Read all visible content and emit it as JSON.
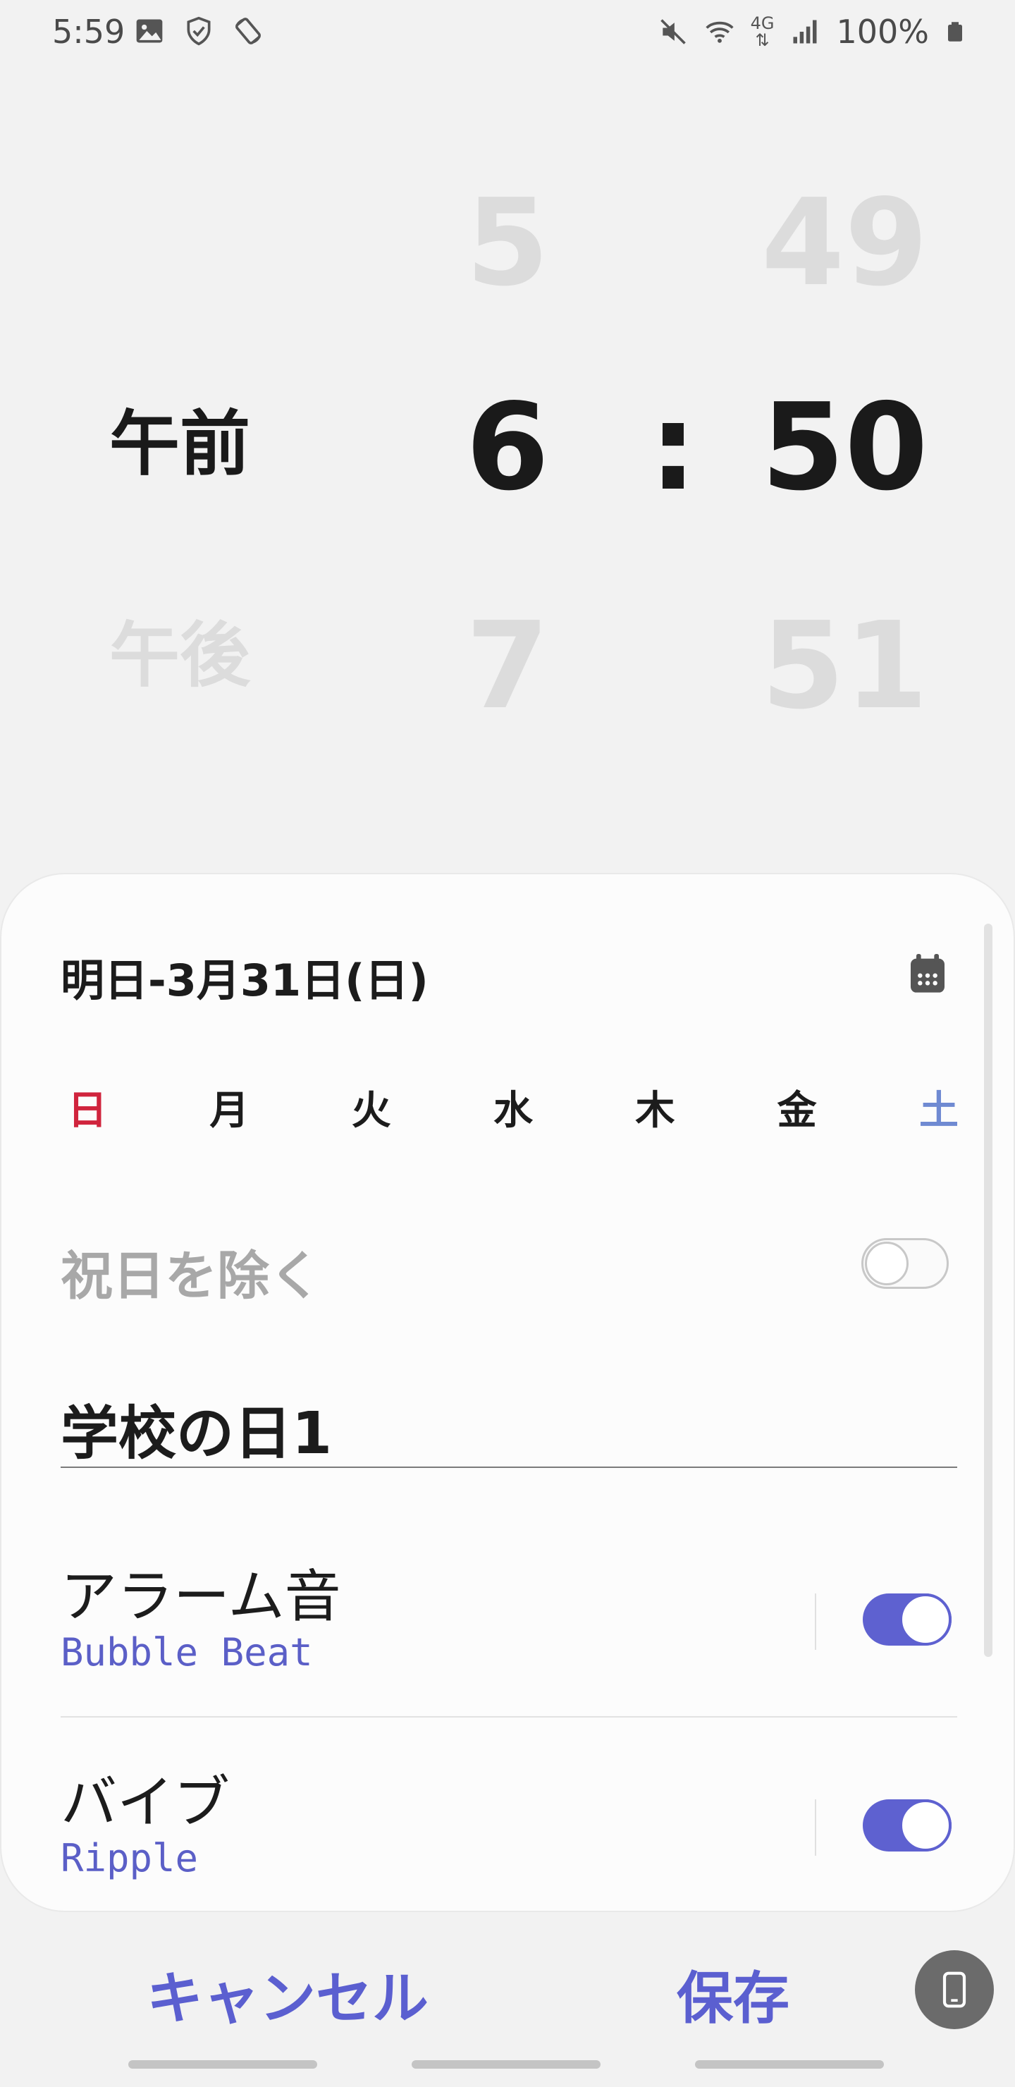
{
  "status_bar": {
    "time": "5:59",
    "battery": "100%",
    "network_label": "4G",
    "left_icons": [
      "image-icon",
      "shield-icon",
      "screen-rotation-icon"
    ],
    "right_icons": [
      "mute-icon",
      "wifi-icon",
      "network-4g-icon",
      "signal-icon",
      "battery-icon"
    ]
  },
  "time_picker": {
    "ampm": {
      "above": "",
      "selected": "午前",
      "below": "午後"
    },
    "hour": {
      "above": "5",
      "selected": "6",
      "below": "7"
    },
    "separator": ":",
    "minute": {
      "above": "49",
      "selected": "50",
      "below": "51"
    }
  },
  "card": {
    "date": "明日-3月31日(日)",
    "calendar_icon": "calendar-icon",
    "days": [
      {
        "label": "日",
        "kind": "sun"
      },
      {
        "label": "月",
        "kind": "weekday"
      },
      {
        "label": "火",
        "kind": "weekday"
      },
      {
        "label": "水",
        "kind": "weekday"
      },
      {
        "label": "木",
        "kind": "weekday"
      },
      {
        "label": "金",
        "kind": "weekday"
      },
      {
        "label": "土",
        "kind": "sat"
      }
    ],
    "holiday_exclude": {
      "label": "祝日を除く",
      "enabled": false
    },
    "alarm_name": "学校の日1",
    "alarm_sound": {
      "title": "アラーム音",
      "value": "Bubble Beat",
      "enabled": true
    },
    "vibration": {
      "title": "バイブ",
      "value": "Ripple",
      "enabled": true
    }
  },
  "actions": {
    "cancel": "キャンセル",
    "save": "保存",
    "device_icon": "phone-icon"
  },
  "colors": {
    "accent": "#5e61d0",
    "sunday": "#d0243d",
    "saturday": "#6f8ad2",
    "faded": "#dcdcdc"
  }
}
